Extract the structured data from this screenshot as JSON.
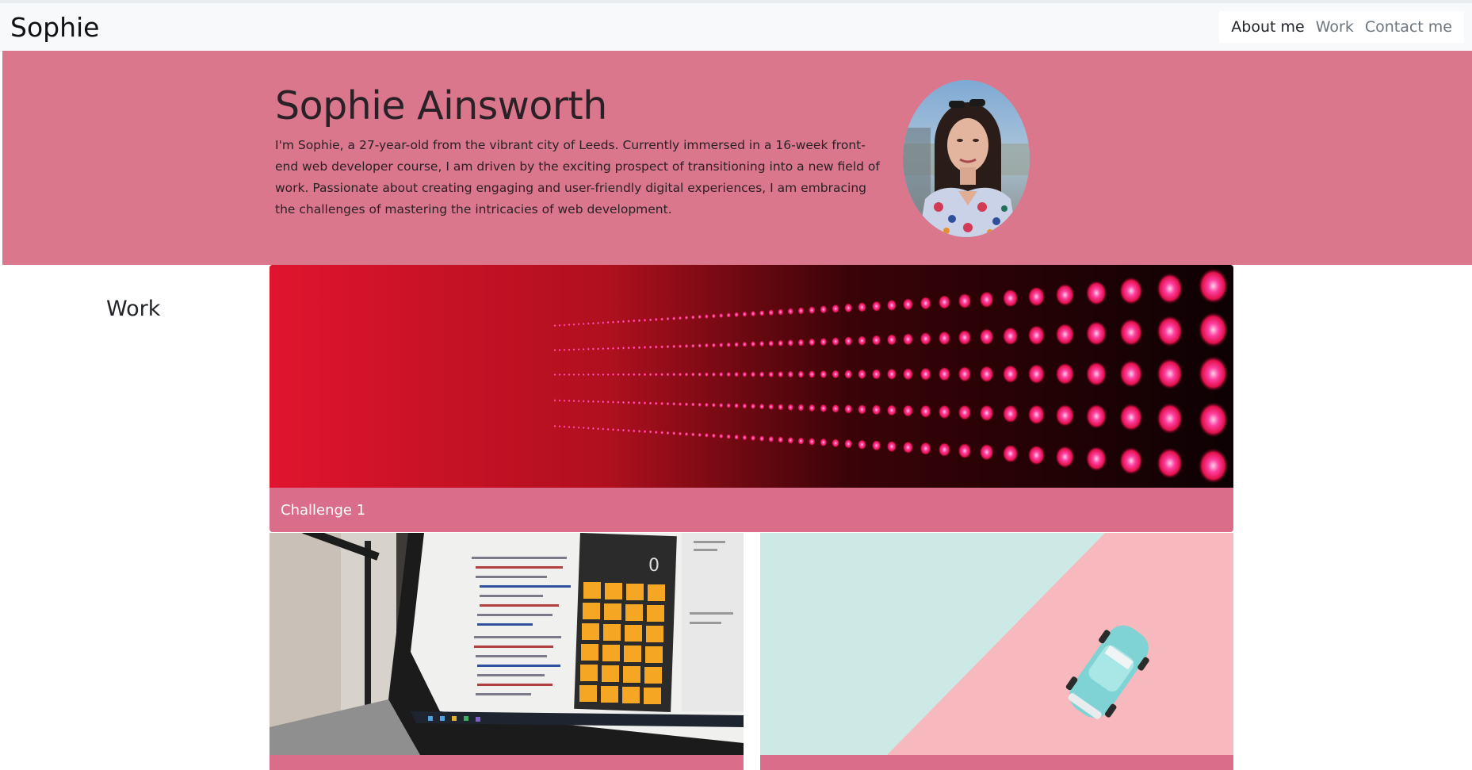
{
  "navbar": {
    "brand": "Sophie",
    "links": [
      {
        "label": "About me",
        "active": true
      },
      {
        "label": "Work",
        "active": false
      },
      {
        "label": "Contact me",
        "active": false
      }
    ]
  },
  "hero": {
    "title": "Sophie Ainsworth",
    "bio": "I'm Sophie, a 27-year-old from the vibrant city of Leeds. Currently immersed in a 16-week front-end web developer course, I am driven by the exciting prospect of transitioning into a new field of work. Passionate about creating engaging and user-friendly digital experiences, I am embracing the challenges of mastering the intricacies of web development.",
    "background_color": "#da778c"
  },
  "work": {
    "heading": "Work",
    "cards": [
      {
        "caption": "Challenge 1",
        "image": "red-led-wall-image"
      },
      {
        "caption": "",
        "image": "laptop-calculator-code-image"
      },
      {
        "caption": "",
        "image": "toy-car-pastel-image"
      }
    ],
    "card_color": "#da6e8a"
  }
}
